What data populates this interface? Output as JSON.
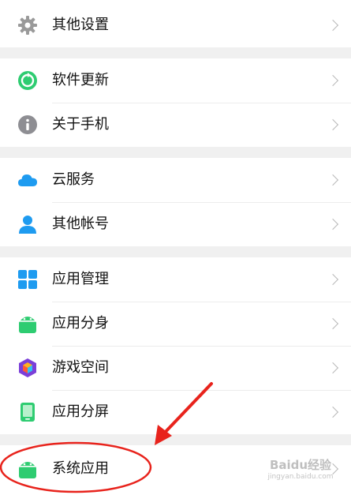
{
  "groups": [
    {
      "items": [
        {
          "label": "其他设置",
          "icon": "gear-icon"
        }
      ]
    },
    {
      "items": [
        {
          "label": "软件更新",
          "icon": "update-icon"
        },
        {
          "label": "关于手机",
          "icon": "info-icon"
        }
      ]
    },
    {
      "items": [
        {
          "label": "云服务",
          "icon": "cloud-icon"
        },
        {
          "label": "其他帐号",
          "icon": "person-icon"
        }
      ]
    },
    {
      "items": [
        {
          "label": "应用管理",
          "icon": "grid-icon"
        },
        {
          "label": "应用分身",
          "icon": "android-icon"
        },
        {
          "label": "游戏空间",
          "icon": "game-cube-icon"
        },
        {
          "label": "应用分屏",
          "icon": "split-screen-icon"
        }
      ]
    },
    {
      "items": [
        {
          "label": "系统应用",
          "icon": "android-icon"
        }
      ]
    }
  ],
  "watermark": {
    "brand": "Baidu经验",
    "site": "jingyan.baidu.com"
  },
  "colors": {
    "accent": "#2ecc71",
    "annotation": "#e8231c",
    "info": "#8e8e93",
    "cloud": "#1e9bf0"
  }
}
